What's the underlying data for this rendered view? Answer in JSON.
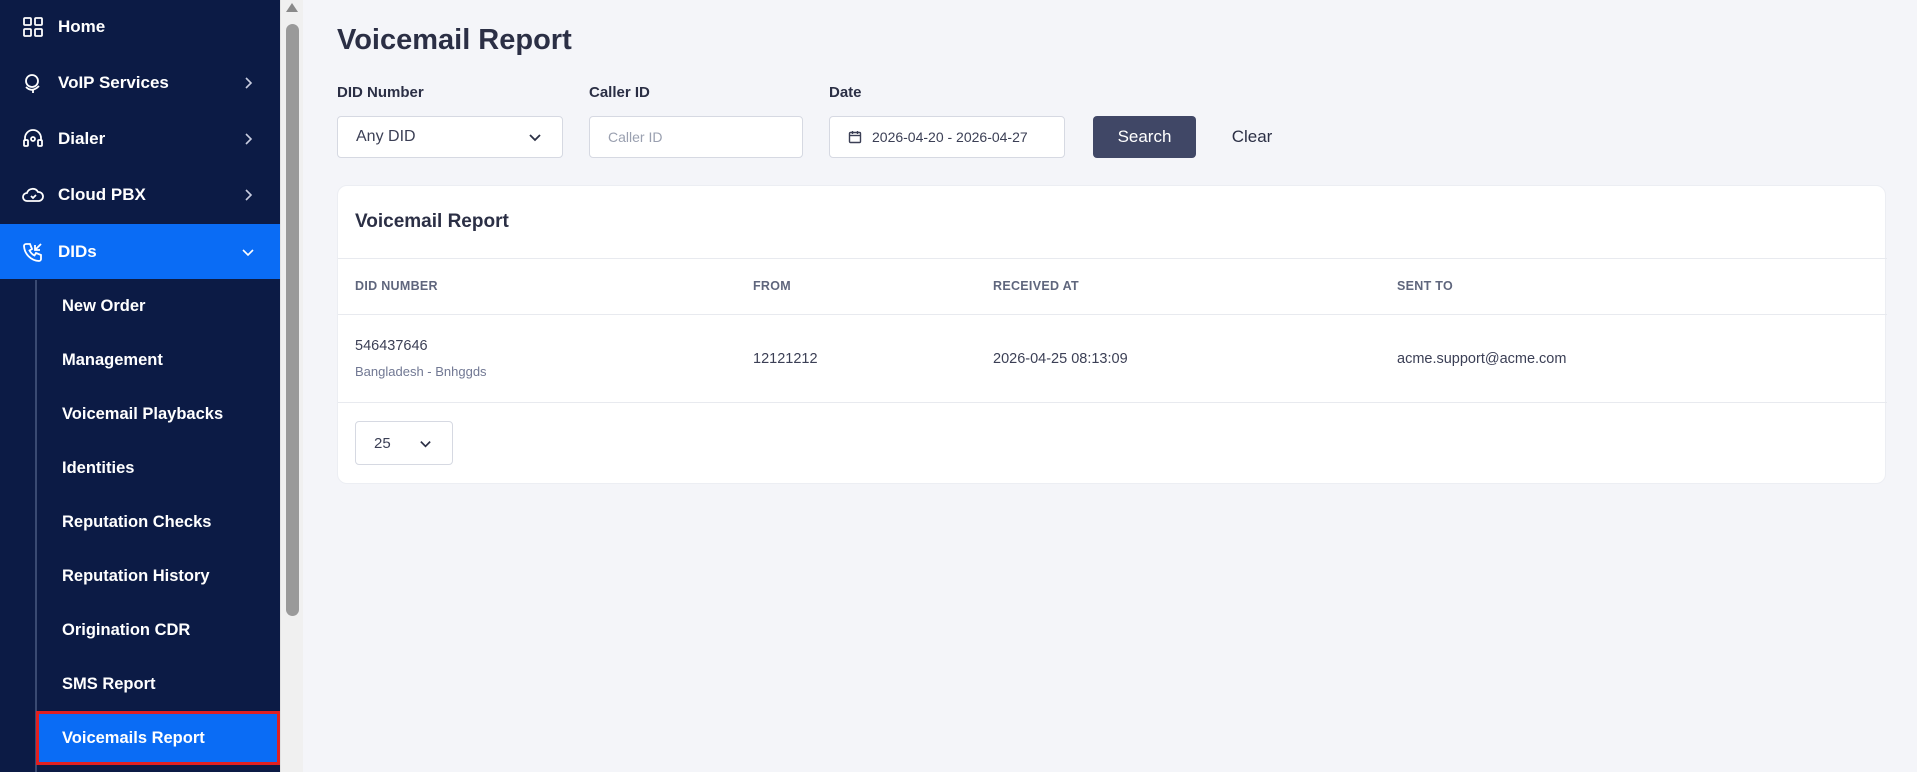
{
  "sidebar": {
    "items": [
      {
        "label": "Home",
        "icon": "grid-icon"
      },
      {
        "label": "VoIP Services",
        "icon": "globe-icon"
      },
      {
        "label": "Dialer",
        "icon": "headset-icon"
      },
      {
        "label": "Cloud PBX",
        "icon": "cloud-phone-icon"
      },
      {
        "label": "DIDs",
        "icon": "phone-incoming-icon"
      }
    ],
    "sub_items": [
      {
        "label": "New Order"
      },
      {
        "label": "Management"
      },
      {
        "label": "Voicemail Playbacks"
      },
      {
        "label": "Identities"
      },
      {
        "label": "Reputation Checks"
      },
      {
        "label": "Reputation History"
      },
      {
        "label": "Origination CDR"
      },
      {
        "label": "SMS Report"
      },
      {
        "label": "Voicemails Report"
      }
    ]
  },
  "page": {
    "title": "Voicemail Report"
  },
  "filters": {
    "did_label": "DID Number",
    "did_value": "Any DID",
    "caller_label": "Caller ID",
    "caller_placeholder": "Caller ID",
    "date_label": "Date",
    "date_value": "2026-04-20 - 2026-04-27",
    "search_label": "Search",
    "clear_label": "Clear"
  },
  "report": {
    "title": "Voicemail Report",
    "columns": [
      "DID NUMBER",
      "FROM",
      "RECEIVED AT",
      "SENT TO"
    ],
    "rows": [
      {
        "did": "546437646",
        "location": "Bangladesh - Bnhggds",
        "from": "12121212",
        "received_at": "2026-04-25 08:13:09",
        "sent_to": "acme.support@acme.com"
      }
    ],
    "page_size": "25"
  },
  "colors": {
    "sidebar_bg": "#0c1b45",
    "active_bg": "#0a6cf5",
    "search_button": "#404766",
    "highlight_outline": "#e02020"
  }
}
